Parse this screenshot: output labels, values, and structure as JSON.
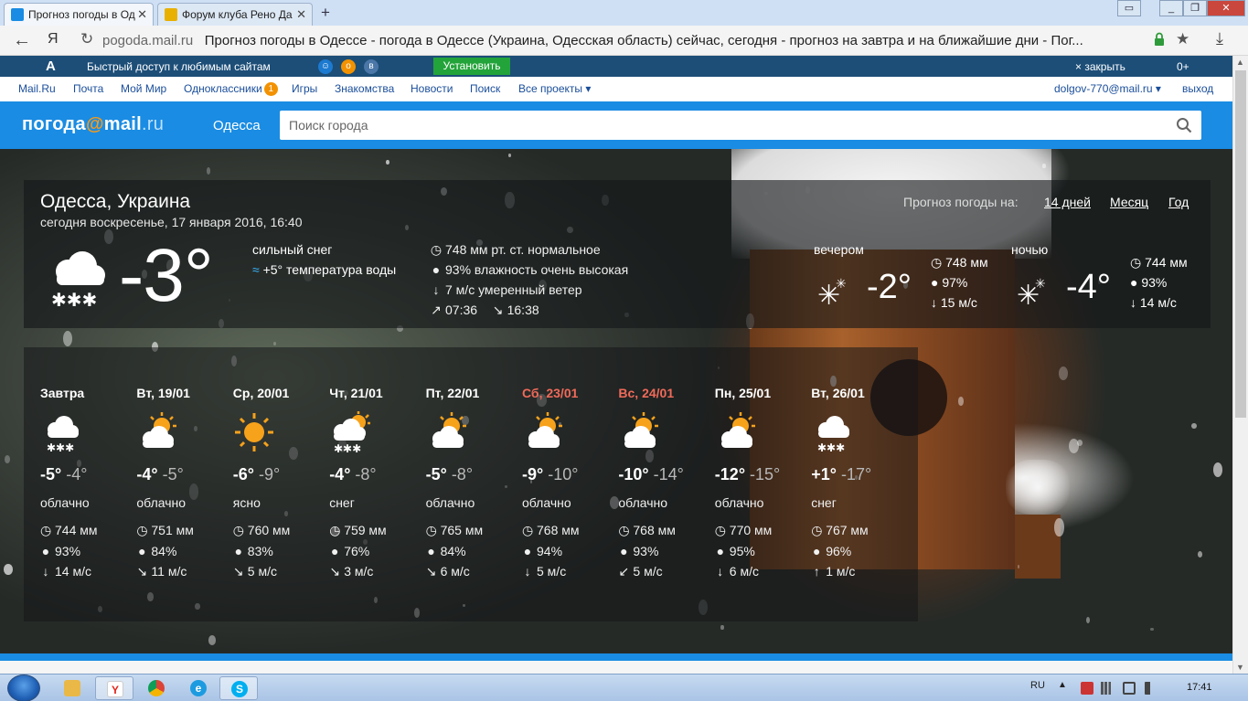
{
  "browser": {
    "tabs": [
      {
        "title": "Прогноз погоды в Од",
        "close": "✕"
      },
      {
        "title": "Форум клуба Рено Да",
        "close": "✕"
      }
    ],
    "new_tab": "+",
    "window_buttons": [
      "▭",
      "_",
      "❐",
      "✕"
    ],
    "back": "←",
    "yandex": "Я",
    "reload": "↻",
    "url_domain": "pogoda.mail.ru",
    "url_title": "Прогноз погоды в Одессе - погода в Одессе (Украина, Одесская область) сейчас, сегодня - прогноз на завтра и на ближайшие дни - Пог...",
    "star": "★",
    "download": "⤓"
  },
  "promo": {
    "logo": "A",
    "text": "Быстрый доступ к любимым сайтам",
    "install": "Установить",
    "close": "× закрыть",
    "age": "0+",
    "icons": [
      "☺",
      "о",
      "в"
    ]
  },
  "portal": {
    "links": [
      "Mail.Ru",
      "Почта",
      "Мой Мир",
      "Одноклассники",
      "Игры",
      "Знакомства",
      "Новости",
      "Поиск",
      "Все проекты ▾"
    ],
    "ok_badge": "1",
    "user": "dolgov-770@mail.ru ▾",
    "logout": "выход"
  },
  "header": {
    "logo_main": "погода",
    "logo_at": "@",
    "logo_mail": "mail",
    "logo_ru": ".ru",
    "city": "Одесса",
    "search_placeholder": "Поиск города"
  },
  "current": {
    "city": "Одесса, Украина",
    "date": "сегодня воскресенье, 17 января 2016, 16:40",
    "forecast_for": "Прогноз погоды на:",
    "forecast_tabs": [
      "14 дней",
      "Месяц",
      "Год"
    ],
    "temp": "-3°",
    "description": "сильный снег",
    "water": "+5° температура воды",
    "pressure": "748 мм рт. ст. нормальное",
    "humidity": "93% влажность очень высокая",
    "wind": "7 м/с умеренный ветер",
    "sunrise": "07:36",
    "sunset": "16:38",
    "evening": {
      "title": "вечером",
      "temp": "-2°",
      "pressure": "748 мм",
      "humidity": "97%",
      "wind": "15 м/с"
    },
    "night": {
      "title": "ночью",
      "temp": "-4°",
      "pressure": "744 мм",
      "humidity": "93%",
      "wind": "14 м/с"
    }
  },
  "forecast": [
    {
      "name": "Завтра",
      "weekend": false,
      "icon": "snow-cloud",
      "day": "-5°",
      "night": "-4°",
      "desc": "облачно",
      "pressure": "744 мм",
      "humidity": "93%",
      "wind_dir": "↓",
      "wind": "14 м/с"
    },
    {
      "name": "Вт, 19/01",
      "weekend": false,
      "icon": "sun-cloud",
      "day": "-4°",
      "night": "-5°",
      "desc": "облачно",
      "pressure": "751 мм",
      "humidity": "84%",
      "wind_dir": "↘",
      "wind": "11 м/с"
    },
    {
      "name": "Ср, 20/01",
      "weekend": false,
      "icon": "sun",
      "day": "-6°",
      "night": "-9°",
      "desc": "ясно",
      "pressure": "760 мм",
      "humidity": "83%",
      "wind_dir": "↘",
      "wind": "5 м/с"
    },
    {
      "name": "Чт, 21/01",
      "weekend": false,
      "icon": "sun-snow",
      "day": "-4°",
      "night": "-8°",
      "desc": "снег",
      "pressure": "759 мм",
      "humidity": "76%",
      "wind_dir": "↘",
      "wind": "3 м/с"
    },
    {
      "name": "Пт, 22/01",
      "weekend": false,
      "icon": "sun-cloud",
      "day": "-5°",
      "night": "-8°",
      "desc": "облачно",
      "pressure": "765 мм",
      "humidity": "84%",
      "wind_dir": "↘",
      "wind": "6 м/с"
    },
    {
      "name": "Сб, 23/01",
      "weekend": true,
      "icon": "sun-cloud",
      "day": "-9°",
      "night": "-10°",
      "desc": "облачно",
      "pressure": "768 мм",
      "humidity": "94%",
      "wind_dir": "↓",
      "wind": "5 м/с"
    },
    {
      "name": "Вс, 24/01",
      "weekend": true,
      "icon": "sun-cloud",
      "day": "-10°",
      "night": "-14°",
      "desc": "облачно",
      "pressure": "768 мм",
      "humidity": "93%",
      "wind_dir": "↙",
      "wind": "5 м/с"
    },
    {
      "name": "Пн, 25/01",
      "weekend": false,
      "icon": "sun-cloud",
      "day": "-12°",
      "night": "-15°",
      "desc": "облачно",
      "pressure": "770 мм",
      "humidity": "95%",
      "wind_dir": "↓",
      "wind": "6 м/с"
    },
    {
      "name": "Вт, 26/01",
      "weekend": false,
      "icon": "snow-cloud",
      "day": "+1°",
      "night": "-17°",
      "desc": "снег",
      "pressure": "767 мм",
      "humidity": "96%",
      "wind_dir": "↑",
      "wind": "1 м/с"
    }
  ],
  "taskbar": {
    "lang": "RU",
    "tray_arrow": "▲",
    "clock": "17:41"
  },
  "colors": {
    "brand_blue": "#1a8ce3",
    "promo_blue": "#1c4e78",
    "install_green": "#23a43a",
    "weekend_red": "#f06a5a",
    "sun_orange": "#f7a21b"
  }
}
